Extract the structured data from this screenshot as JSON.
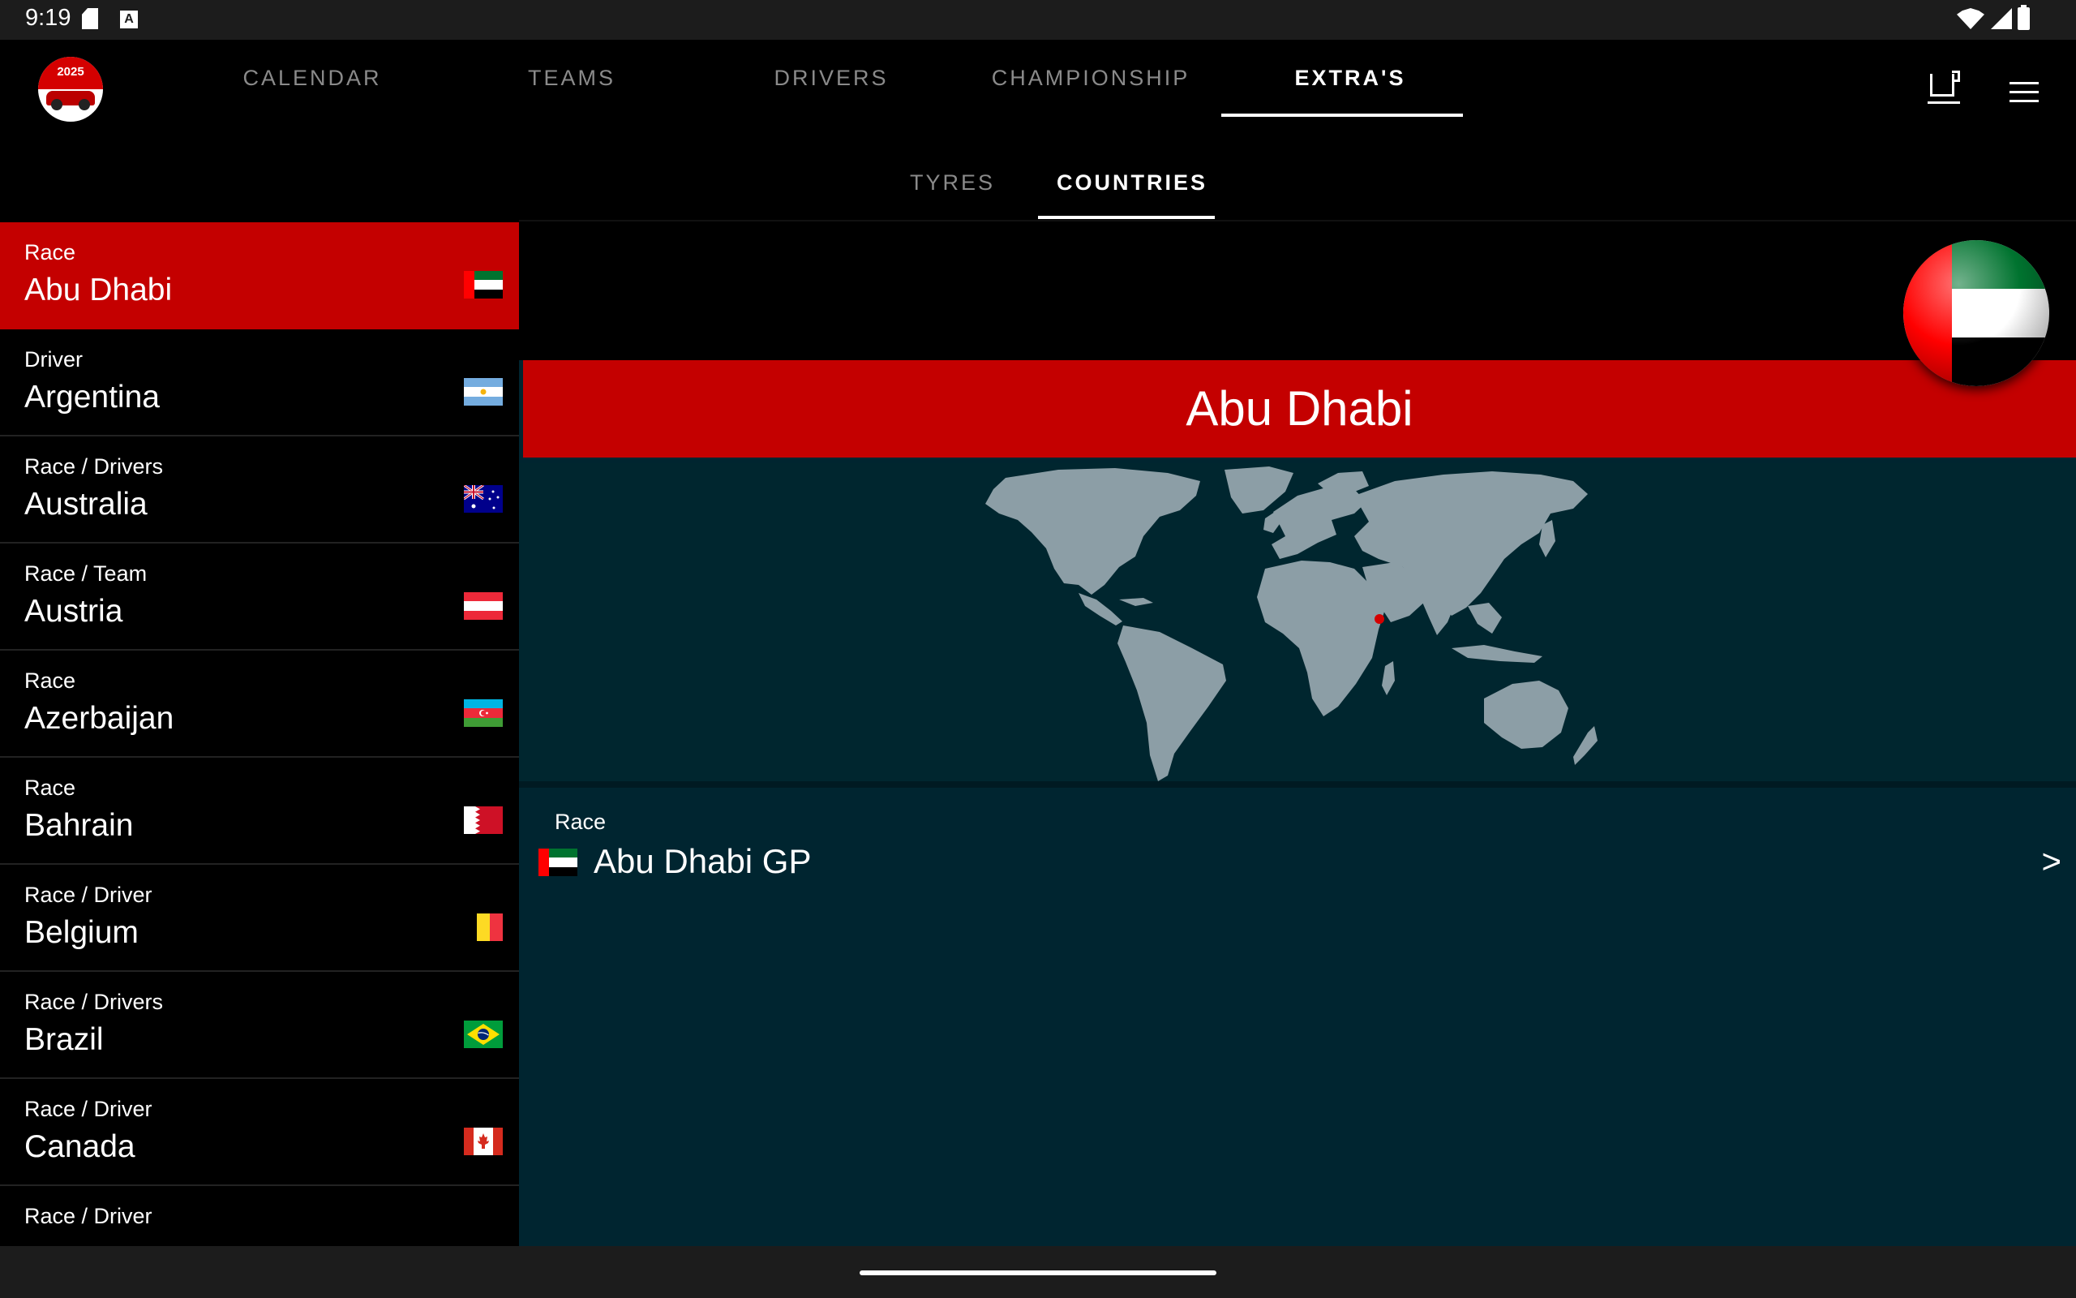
{
  "status_bar": {
    "time": "9:19",
    "a_icon": "A"
  },
  "app": {
    "logo_year": "2025",
    "nav_tabs": [
      {
        "label": "CALENDAR",
        "active": false
      },
      {
        "label": "TEAMS",
        "active": false
      },
      {
        "label": "DRIVERS",
        "active": false
      },
      {
        "label": "CHAMPIONSHIP",
        "active": false
      },
      {
        "label": "EXTRA'S",
        "active": true
      }
    ],
    "sub_tabs": [
      {
        "label": "TYRES",
        "active": false
      },
      {
        "label": "COUNTRIES",
        "active": true
      }
    ],
    "icons": [
      "cup-icon",
      "menu-icon"
    ]
  },
  "countries": [
    {
      "type": "Race",
      "name": "Abu Dhabi",
      "flag": "uae",
      "selected": true
    },
    {
      "type": "Driver",
      "name": "Argentina",
      "flag": "argentina"
    },
    {
      "type": "Race / Drivers",
      "name": "Australia",
      "flag": "australia"
    },
    {
      "type": "Race / Team",
      "name": "Austria",
      "flag": "austria"
    },
    {
      "type": "Race",
      "name": "Azerbaijan",
      "flag": "azerbaijan"
    },
    {
      "type": "Race",
      "name": "Bahrain",
      "flag": "bahrain"
    },
    {
      "type": "Race / Driver",
      "name": "Belgium",
      "flag": "belgium"
    },
    {
      "type": "Race / Drivers",
      "name": "Brazil",
      "flag": "brazil"
    },
    {
      "type": "Race / Driver",
      "name": "Canada",
      "flag": "canada"
    },
    {
      "type": "Race / Driver",
      "name": "",
      "flag": ""
    }
  ],
  "detail": {
    "title": "Abu Dhabi",
    "section_label": "Race",
    "race_name": "Abu Dhabi GP",
    "chevron": ">",
    "colors": {
      "accent": "#c40000",
      "panel": "#002530",
      "land": "#8c9ea6",
      "marker": "#d40000"
    }
  }
}
